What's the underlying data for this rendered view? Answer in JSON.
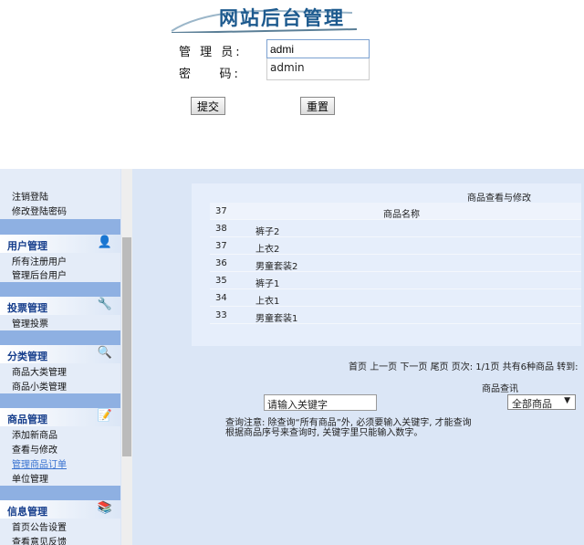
{
  "login": {
    "logo_title": "网站后台管理",
    "admin_label": "管 理 员:",
    "password_label": "密    码:",
    "username_value": "admi",
    "autocomplete_suggestion": "admin",
    "submit_label": "提交",
    "reset_label": "重置"
  },
  "sidebar": {
    "top_items": [
      "注销登陆",
      "修改登陆密码"
    ],
    "groups": [
      {
        "title": "用户管理",
        "icon": "user-icon",
        "items": [
          "所有注册用户",
          "管理后台用户"
        ]
      },
      {
        "title": "投票管理",
        "icon": "vote-icon",
        "items": [
          "管理投票"
        ]
      },
      {
        "title": "分类管理",
        "icon": "search-icon",
        "items": [
          "商品大类管理",
          "商品小类管理"
        ]
      },
      {
        "title": "商品管理",
        "icon": "edit-icon",
        "items": [
          "添加新商品",
          "查看与修改",
          "管理商品订单",
          "单位管理"
        ]
      },
      {
        "title": "信息管理",
        "icon": "info-icon",
        "items": [
          "首页公告设置",
          "查看意见反馈"
        ]
      }
    ]
  },
  "main": {
    "table_title": "商品查看与修改",
    "col_id": "37",
    "col_name": "商品名称",
    "rows": [
      {
        "id": "38",
        "name": "裤子2"
      },
      {
        "id": "37",
        "name": "上衣2"
      },
      {
        "id": "36",
        "name": "男童套装2"
      },
      {
        "id": "35",
        "name": "裤子1"
      },
      {
        "id": "34",
        "name": "上衣1"
      },
      {
        "id": "33",
        "name": "男童套装1"
      }
    ],
    "pagination": {
      "first": "首页",
      "prev": "上一页",
      "next": "下一页",
      "last": "尾页",
      "page_info": "页次: 1/1页",
      "total": "共有6种商品",
      "goto": "转到:"
    },
    "search_title": "商品查讯",
    "search_placeholder": "请输入关键字",
    "category_select": "全部商品",
    "note_line1": "查询注意: 除查询“所有商品”外, 必须要输入关键字, 才能查询",
    "note_line2": "根据商品序号来查询时, 关键字里只能输入数字。"
  }
}
